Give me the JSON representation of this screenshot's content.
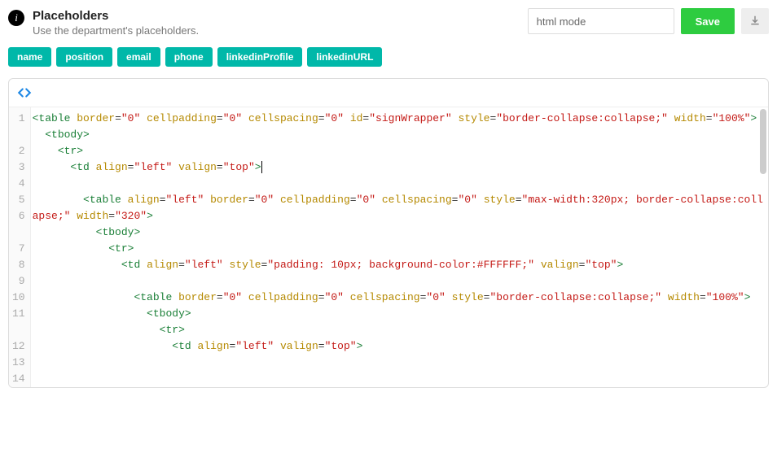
{
  "header": {
    "title": "Placeholders",
    "subtitle": "Use the department's placeholders."
  },
  "controls": {
    "mode_value": "html mode",
    "save_label": "Save"
  },
  "tags": [
    "name",
    "position",
    "email",
    "phone",
    "linkedinProfile",
    "linkedinURL"
  ],
  "editor": {
    "line_count": 14,
    "code_lines": [
      {
        "n": 1,
        "tokens": [
          {
            "t": "punc",
            "v": "<"
          },
          {
            "t": "tag",
            "v": "table"
          },
          {
            "t": "plain",
            "v": " "
          },
          {
            "t": "attr",
            "v": "border"
          },
          {
            "t": "plain",
            "v": "="
          },
          {
            "t": "str",
            "v": "\"0\""
          },
          {
            "t": "plain",
            "v": " "
          },
          {
            "t": "attr",
            "v": "cellpadding"
          },
          {
            "t": "plain",
            "v": "="
          },
          {
            "t": "str",
            "v": "\"0\""
          },
          {
            "t": "plain",
            "v": " "
          },
          {
            "t": "attr",
            "v": "cellspacing"
          },
          {
            "t": "plain",
            "v": "="
          },
          {
            "t": "str",
            "v": "\"0\""
          },
          {
            "t": "plain",
            "v": " "
          },
          {
            "t": "attr",
            "v": "id"
          },
          {
            "t": "plain",
            "v": "="
          },
          {
            "t": "str",
            "v": "\"signWrapper\""
          },
          {
            "t": "plain",
            "v": " "
          },
          {
            "t": "attr",
            "v": "style"
          },
          {
            "t": "plain",
            "v": "="
          },
          {
            "t": "str",
            "v": "\"border-collapse:collapse;\""
          },
          {
            "t": "plain",
            "v": " "
          },
          {
            "t": "attr",
            "v": "width"
          },
          {
            "t": "plain",
            "v": "="
          },
          {
            "t": "str",
            "v": "\"100%\""
          },
          {
            "t": "punc",
            "v": ">"
          }
        ]
      },
      {
        "n": 2,
        "indent": 2,
        "tokens": [
          {
            "t": "punc",
            "v": "<"
          },
          {
            "t": "tag",
            "v": "tbody"
          },
          {
            "t": "punc",
            "v": ">"
          }
        ]
      },
      {
        "n": 3,
        "indent": 4,
        "tokens": [
          {
            "t": "punc",
            "v": "<"
          },
          {
            "t": "tag",
            "v": "tr"
          },
          {
            "t": "punc",
            "v": ">"
          }
        ]
      },
      {
        "n": 4,
        "indent": 6,
        "tokens": [
          {
            "t": "punc",
            "v": "<"
          },
          {
            "t": "tag",
            "v": "td"
          },
          {
            "t": "plain",
            "v": " "
          },
          {
            "t": "attr",
            "v": "align"
          },
          {
            "t": "plain",
            "v": "="
          },
          {
            "t": "str",
            "v": "\"left\""
          },
          {
            "t": "plain",
            "v": " "
          },
          {
            "t": "attr",
            "v": "valign"
          },
          {
            "t": "plain",
            "v": "="
          },
          {
            "t": "str",
            "v": "\"top\""
          },
          {
            "t": "punc",
            "v": ">"
          },
          {
            "t": "cursor",
            "v": ""
          }
        ]
      },
      {
        "n": 5,
        "tokens": []
      },
      {
        "n": 6,
        "indent": 8,
        "tokens": [
          {
            "t": "punc",
            "v": "<"
          },
          {
            "t": "tag",
            "v": "table"
          },
          {
            "t": "plain",
            "v": " "
          },
          {
            "t": "attr",
            "v": "align"
          },
          {
            "t": "plain",
            "v": "="
          },
          {
            "t": "str",
            "v": "\"left\""
          },
          {
            "t": "plain",
            "v": " "
          },
          {
            "t": "attr",
            "v": "border"
          },
          {
            "t": "plain",
            "v": "="
          },
          {
            "t": "str",
            "v": "\"0\""
          },
          {
            "t": "plain",
            "v": " "
          },
          {
            "t": "attr",
            "v": "cellpadding"
          },
          {
            "t": "plain",
            "v": "="
          },
          {
            "t": "str",
            "v": "\"0\""
          },
          {
            "t": "plain",
            "v": " "
          },
          {
            "t": "attr",
            "v": "cellspacing"
          },
          {
            "t": "plain",
            "v": "="
          },
          {
            "t": "str",
            "v": "\"0\""
          },
          {
            "t": "plain",
            "v": " "
          },
          {
            "t": "attr",
            "v": "style"
          },
          {
            "t": "plain",
            "v": "="
          },
          {
            "t": "str",
            "v": "\"max-width:320px; border-collapse:collapse;\""
          },
          {
            "t": "plain",
            "v": " "
          },
          {
            "t": "attr",
            "v": "width"
          },
          {
            "t": "plain",
            "v": "="
          },
          {
            "t": "str",
            "v": "\"320\""
          },
          {
            "t": "punc",
            "v": ">"
          }
        ]
      },
      {
        "n": 7,
        "indent": 10,
        "tokens": [
          {
            "t": "punc",
            "v": "<"
          },
          {
            "t": "tag",
            "v": "tbody"
          },
          {
            "t": "punc",
            "v": ">"
          }
        ]
      },
      {
        "n": 8,
        "indent": 12,
        "tokens": [
          {
            "t": "punc",
            "v": "<"
          },
          {
            "t": "tag",
            "v": "tr"
          },
          {
            "t": "punc",
            "v": ">"
          }
        ]
      },
      {
        "n": 9,
        "indent": 14,
        "tokens": [
          {
            "t": "punc",
            "v": "<"
          },
          {
            "t": "tag",
            "v": "td"
          },
          {
            "t": "plain",
            "v": " "
          },
          {
            "t": "attr",
            "v": "align"
          },
          {
            "t": "plain",
            "v": "="
          },
          {
            "t": "str",
            "v": "\"left\""
          },
          {
            "t": "plain",
            "v": " "
          },
          {
            "t": "attr",
            "v": "style"
          },
          {
            "t": "plain",
            "v": "="
          },
          {
            "t": "str",
            "v": "\"padding: 10px; background-color:#FFFFFF;\""
          },
          {
            "t": "plain",
            "v": " "
          },
          {
            "t": "attr",
            "v": "valign"
          },
          {
            "t": "plain",
            "v": "="
          },
          {
            "t": "str",
            "v": "\"top\""
          },
          {
            "t": "punc",
            "v": ">"
          }
        ]
      },
      {
        "n": 10,
        "tokens": []
      },
      {
        "n": 11,
        "indent": 16,
        "tokens": [
          {
            "t": "punc",
            "v": "<"
          },
          {
            "t": "tag",
            "v": "table"
          },
          {
            "t": "plain",
            "v": " "
          },
          {
            "t": "attr",
            "v": "border"
          },
          {
            "t": "plain",
            "v": "="
          },
          {
            "t": "str",
            "v": "\"0\""
          },
          {
            "t": "plain",
            "v": " "
          },
          {
            "t": "attr",
            "v": "cellpadding"
          },
          {
            "t": "plain",
            "v": "="
          },
          {
            "t": "str",
            "v": "\"0\""
          },
          {
            "t": "plain",
            "v": " "
          },
          {
            "t": "attr",
            "v": "cellspacing"
          },
          {
            "t": "plain",
            "v": "="
          },
          {
            "t": "str",
            "v": "\"0\""
          },
          {
            "t": "plain",
            "v": " "
          },
          {
            "t": "attr",
            "v": "style"
          },
          {
            "t": "plain",
            "v": "="
          },
          {
            "t": "str",
            "v": "\"border-collapse:collapse;\""
          },
          {
            "t": "plain",
            "v": " "
          },
          {
            "t": "attr",
            "v": "width"
          },
          {
            "t": "plain",
            "v": "="
          },
          {
            "t": "str",
            "v": "\"100%\""
          },
          {
            "t": "punc",
            "v": ">"
          }
        ]
      },
      {
        "n": 12,
        "indent": 18,
        "tokens": [
          {
            "t": "punc",
            "v": "<"
          },
          {
            "t": "tag",
            "v": "tbody"
          },
          {
            "t": "punc",
            "v": ">"
          }
        ]
      },
      {
        "n": 13,
        "indent": 20,
        "tokens": [
          {
            "t": "punc",
            "v": "<"
          },
          {
            "t": "tag",
            "v": "tr"
          },
          {
            "t": "punc",
            "v": ">"
          }
        ]
      },
      {
        "n": 14,
        "indent": 22,
        "tokens": [
          {
            "t": "punc",
            "v": "<"
          },
          {
            "t": "tag",
            "v": "td"
          },
          {
            "t": "plain",
            "v": " "
          },
          {
            "t": "attr",
            "v": "align"
          },
          {
            "t": "plain",
            "v": "="
          },
          {
            "t": "str",
            "v": "\"left\""
          },
          {
            "t": "plain",
            "v": " "
          },
          {
            "t": "attr",
            "v": "valign"
          },
          {
            "t": "plain",
            "v": "="
          },
          {
            "t": "str",
            "v": "\"top\""
          },
          {
            "t": "punc",
            "v": ">"
          }
        ]
      }
    ],
    "wrapped_lines_after": [
      1,
      6,
      11
    ]
  }
}
